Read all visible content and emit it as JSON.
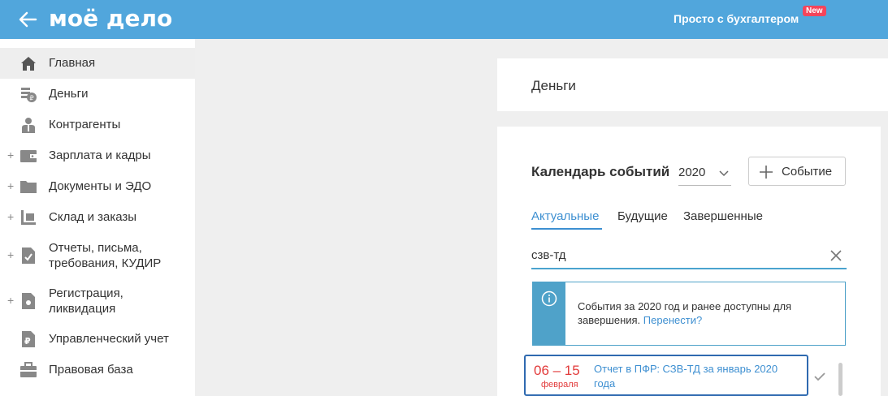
{
  "header": {
    "logo_text": "моё дело",
    "promo_text": "Просто с бухгалтером",
    "new_badge": "New",
    "bg_color": "#51a6dc"
  },
  "sidebar": {
    "items": [
      {
        "label": "Главная",
        "icon": "home-icon",
        "expandable": false,
        "active": true
      },
      {
        "label": "Деньги",
        "icon": "money-icon",
        "expandable": false
      },
      {
        "label": "Контрагенты",
        "icon": "contractors-icon",
        "expandable": false
      },
      {
        "label": "Зарплата и кадры",
        "icon": "wallet-icon",
        "expandable": true
      },
      {
        "label": "Документы и ЭДО",
        "icon": "folder-icon",
        "expandable": true
      },
      {
        "label": "Склад и заказы",
        "icon": "warehouse-icon",
        "expandable": true
      },
      {
        "label": "Отчеты, письма, требования, КУДИР",
        "icon": "report-icon",
        "expandable": true
      },
      {
        "label": "Регистрация, ликвидация",
        "icon": "registration-icon",
        "expandable": true
      },
      {
        "label": "Управленческий учет",
        "icon": "ruble-doc-icon",
        "expandable": false
      },
      {
        "label": "Правовая база",
        "icon": "briefcase-icon",
        "expandable": false
      }
    ],
    "plus_symbol": "+"
  },
  "main": {
    "page_title": "Деньги",
    "calendar": {
      "title": "Календарь событий",
      "year": "2020",
      "add_event_label": "Событие",
      "tabs": [
        {
          "label": "Актуальные",
          "active": true
        },
        {
          "label": "Будущие",
          "active": false
        },
        {
          "label": "Завершенные",
          "active": false
        }
      ],
      "search_value": "сзв-тд",
      "info": {
        "text": "События за 2020 год и ранее доступны для завершения.",
        "link": "Перенести?"
      },
      "events": [
        {
          "date_range": "06 – 15",
          "month": "февраля",
          "title": "Отчет в ПФР: СЗВ-ТД за январь 2020 года"
        }
      ]
    }
  },
  "colors": {
    "accent": "#3d8fd1",
    "date_red": "#e23b3b",
    "info_blue": "#4fa2c9"
  }
}
